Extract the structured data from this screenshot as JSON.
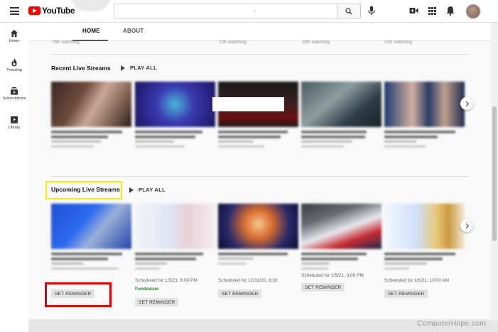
{
  "topbar": {
    "logo_text": "YouTube",
    "icons": [
      "menu-icon",
      "search-icon",
      "microphone-icon",
      "video-camera-icon",
      "apps-icon",
      "bell-icon"
    ]
  },
  "sidebar": {
    "items": [
      {
        "label": "Home",
        "icon": "home-icon"
      },
      {
        "label": "Trending",
        "icon": "flame-icon"
      },
      {
        "label": "Subscriptions",
        "icon": "subscriptions-icon"
      },
      {
        "label": "Library",
        "icon": "library-icon"
      }
    ]
  },
  "tabs": {
    "home": "HOME",
    "about": "ABOUT"
  },
  "live_top_row": {
    "watching": [
      "78K watching",
      "12K watching",
      "18K watching",
      "31K watching"
    ]
  },
  "recent": {
    "title": "Recent Live Streams",
    "play_all": "PLAY ALL"
  },
  "upcoming": {
    "title": "Upcoming Live Streams",
    "play_all": "PLAY ALL",
    "items": [
      {
        "scheduled": "",
        "reminder": "SET REMINDER"
      },
      {
        "scheduled": "Scheduled for 1/5/21, 6:00 PM",
        "badge": "Fundraiser",
        "reminder": "SET REMINDER"
      },
      {
        "scheduled": "Scheduled for 12/31/20, 8:30",
        "reminder": "SET REMINDER"
      },
      {
        "scheduled": "Scheduled for 1/5/21, 3:00 PM",
        "reminder": "SET REMINDER"
      },
      {
        "scheduled": "Scheduled for 1/6/21, 10:00 AM",
        "reminder": "SET REMINDER"
      }
    ]
  },
  "watermark": "ComputerHope.com",
  "colors": {
    "brand_red": "#ff0000",
    "highlight_yellow": "#f7ee00",
    "highlight_red": "#e00000",
    "fundraiser_green": "#2e7d32"
  }
}
